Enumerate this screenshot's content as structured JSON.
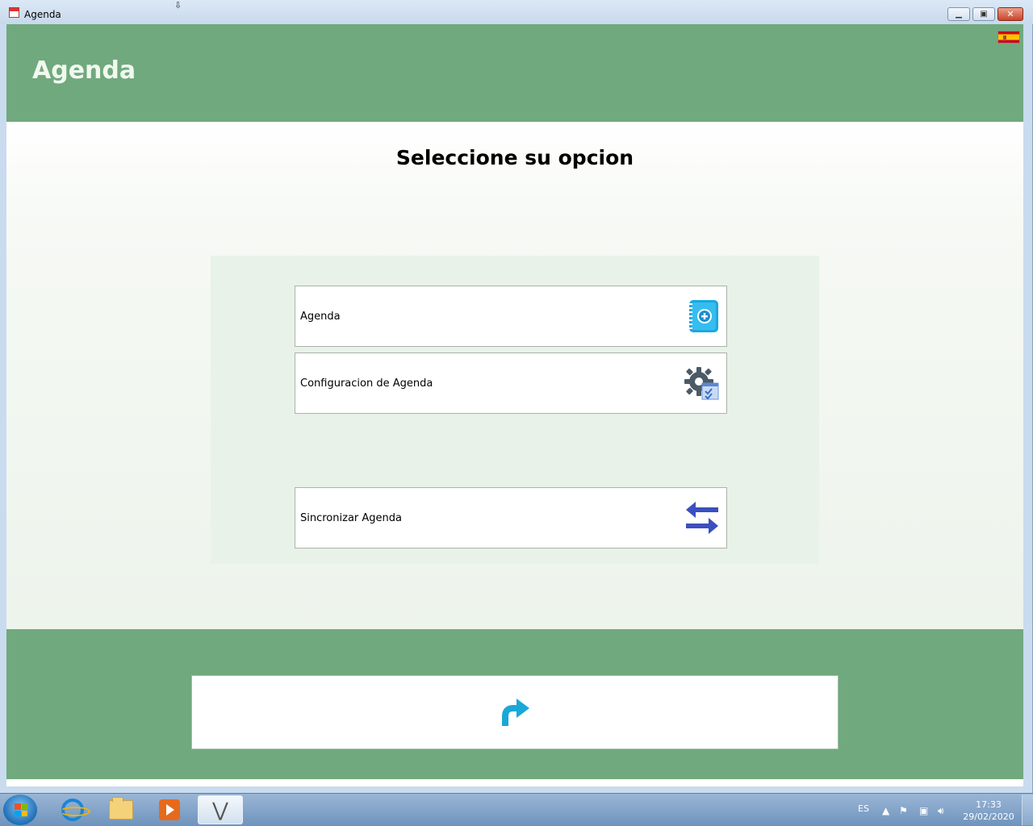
{
  "window": {
    "title": "Agenda",
    "minimize_label": "▭",
    "maximize_label": "▢",
    "close_label": "✕"
  },
  "header": {
    "title": "Agenda",
    "language_flag": "spain-flag-icon"
  },
  "main": {
    "title": "Seleccione su opcion",
    "options": [
      {
        "label": "Agenda",
        "icon": "agenda-add-icon"
      },
      {
        "label": "Configuracion de Agenda",
        "icon": "settings-gear-icon"
      },
      {
        "label": "Sincronizar Agenda",
        "icon": "sync-arrows-icon"
      }
    ]
  },
  "footer": {
    "back_icon": "redo-arrow-icon"
  },
  "taskbar": {
    "language": "ES",
    "time": "17:33",
    "date": "29/02/2020"
  },
  "colors": {
    "header_green": "#70a97e",
    "panel_green": "#e9f2e8",
    "accent_blue": "#1a9fd8",
    "sync_blue": "#3b4fbf"
  }
}
